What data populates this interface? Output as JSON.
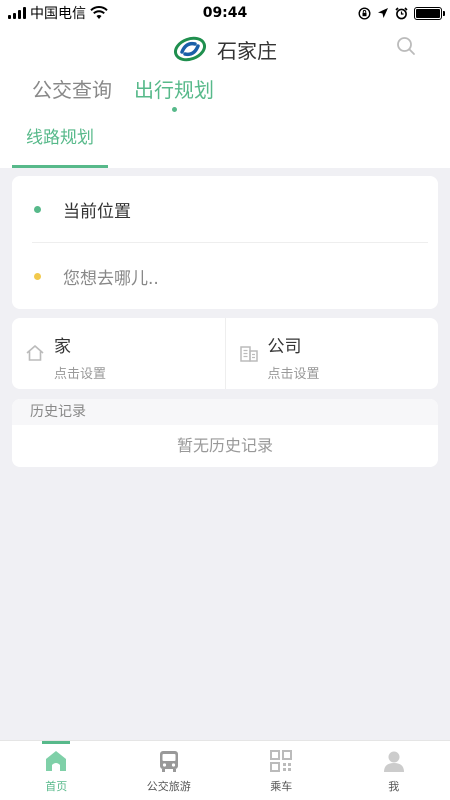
{
  "status": {
    "carrier": "中国电信",
    "time": "09:44"
  },
  "header": {
    "city": "石家庄",
    "tabs": [
      {
        "label": "公交查询",
        "active": false
      },
      {
        "label": "出行规划",
        "active": true
      }
    ],
    "sub_tab": "线路规划"
  },
  "route": {
    "from_label": "当前位置",
    "to_placeholder": "您想去哪儿.."
  },
  "places": [
    {
      "name": "家",
      "hint": "点击设置",
      "icon": "home-icon"
    },
    {
      "name": "公司",
      "hint": "点击设置",
      "icon": "building-icon"
    }
  ],
  "history": {
    "title": "历史记录",
    "empty": "暂无历史记录"
  },
  "tabbar": [
    {
      "label": "首页",
      "icon": "home-icon",
      "active": true
    },
    {
      "label": "公交旅游",
      "icon": "bus-icon",
      "active": false
    },
    {
      "label": "乘车",
      "icon": "qr-icon",
      "active": false
    },
    {
      "label": "我",
      "icon": "user-icon",
      "active": false
    }
  ],
  "colors": {
    "accent": "#57b98a",
    "origin_dot": "#57b98a",
    "destination_dot": "#f2c94c",
    "background": "#f0f0f4"
  }
}
